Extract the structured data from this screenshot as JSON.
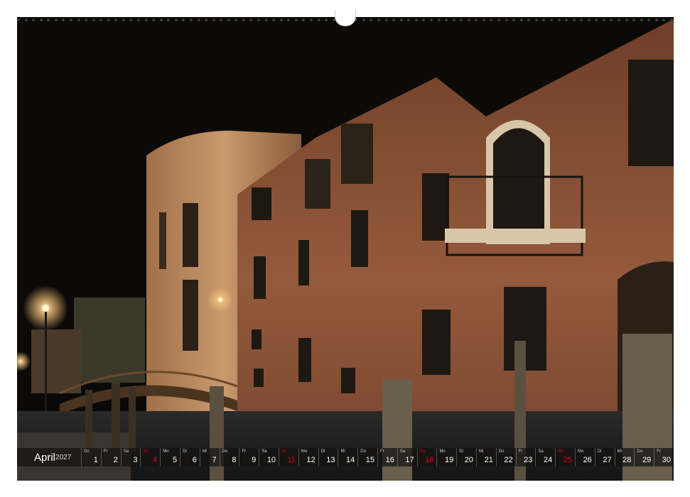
{
  "calendar": {
    "month": "April",
    "year": "2027",
    "days": [
      {
        "wd": "Do",
        "d": "1"
      },
      {
        "wd": "Fr",
        "d": "2"
      },
      {
        "wd": "Sa",
        "d": "3"
      },
      {
        "wd": "So",
        "d": "4",
        "sun": true
      },
      {
        "wd": "Mo",
        "d": "5"
      },
      {
        "wd": "Di",
        "d": "6"
      },
      {
        "wd": "Mi",
        "d": "7"
      },
      {
        "wd": "Do",
        "d": "8"
      },
      {
        "wd": "Fr",
        "d": "9"
      },
      {
        "wd": "Sa",
        "d": "10"
      },
      {
        "wd": "So",
        "d": "11",
        "sun": true
      },
      {
        "wd": "Mo",
        "d": "12"
      },
      {
        "wd": "Di",
        "d": "13"
      },
      {
        "wd": "Mi",
        "d": "14"
      },
      {
        "wd": "Do",
        "d": "15"
      },
      {
        "wd": "Fr",
        "d": "16"
      },
      {
        "wd": "Sa",
        "d": "17"
      },
      {
        "wd": "So",
        "d": "18",
        "sun": true
      },
      {
        "wd": "Mo",
        "d": "19"
      },
      {
        "wd": "Di",
        "d": "20"
      },
      {
        "wd": "Mi",
        "d": "21"
      },
      {
        "wd": "Do",
        "d": "22"
      },
      {
        "wd": "Fr",
        "d": "23"
      },
      {
        "wd": "Sa",
        "d": "24"
      },
      {
        "wd": "So",
        "d": "25",
        "sun": true
      },
      {
        "wd": "Mo",
        "d": "26"
      },
      {
        "wd": "Di",
        "d": "27"
      },
      {
        "wd": "Mi",
        "d": "28"
      },
      {
        "wd": "Do",
        "d": "29"
      },
      {
        "wd": "Fr",
        "d": "30"
      }
    ]
  },
  "colors": {
    "sunday": "#e2001a",
    "brick": "#8a5236",
    "sky": "#0c0a08"
  }
}
